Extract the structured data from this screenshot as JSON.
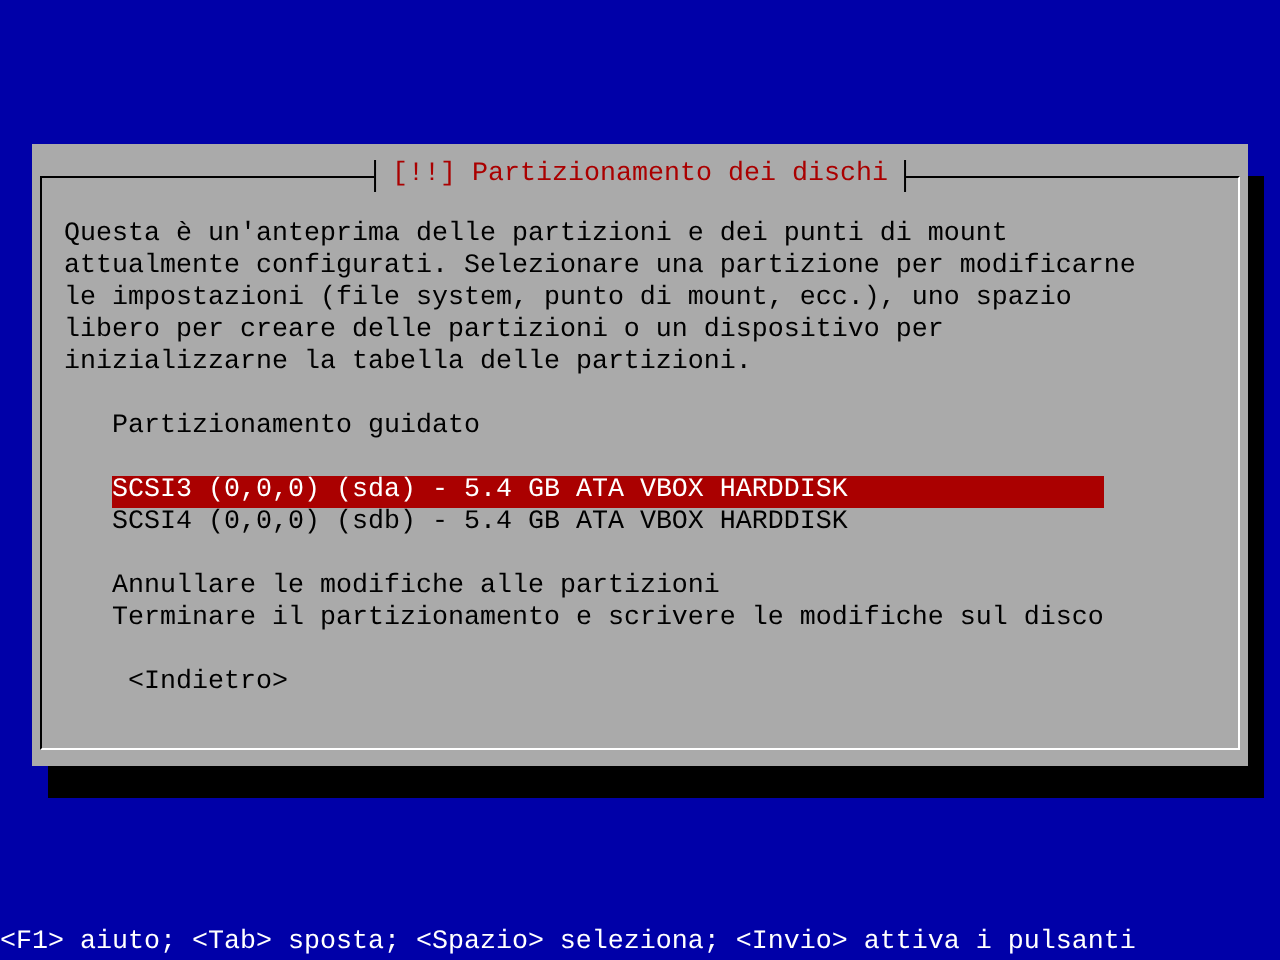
{
  "dialog": {
    "title": "[!!] Partizionamento dei dischi",
    "description": "Questa è un'anteprima delle partizioni e dei punti di mount\nattualmente configurati. Selezionare una partizione per modificarne\nle impostazioni (file system, punto di mount, ecc.), uno spazio\nlibero per creare delle partizioni o un dispositivo per\ninizializzarne la tabella delle partizioni.",
    "menu_groups": [
      {
        "items": [
          {
            "label": "Partizionamento guidato",
            "selected": false
          }
        ]
      },
      {
        "items": [
          {
            "label": "SCSI3 (0,0,0) (sda) - 5.4 GB ATA VBOX HARDDISK",
            "selected": true
          },
          {
            "label": "SCSI4 (0,0,0) (sdb) - 5.4 GB ATA VBOX HARDDISK",
            "selected": false
          }
        ]
      },
      {
        "items": [
          {
            "label": "Annullare le modifiche alle partizioni",
            "selected": false
          },
          {
            "label": "Terminare il partizionamento e scrivere le modifiche sul disco",
            "selected": false
          }
        ]
      }
    ],
    "buttons": [
      "<Indietro>"
    ]
  },
  "help_line": "<F1> aiuto; <Tab> sposta; <Spazio> seleziona; <Invio> attiva i pulsanti"
}
